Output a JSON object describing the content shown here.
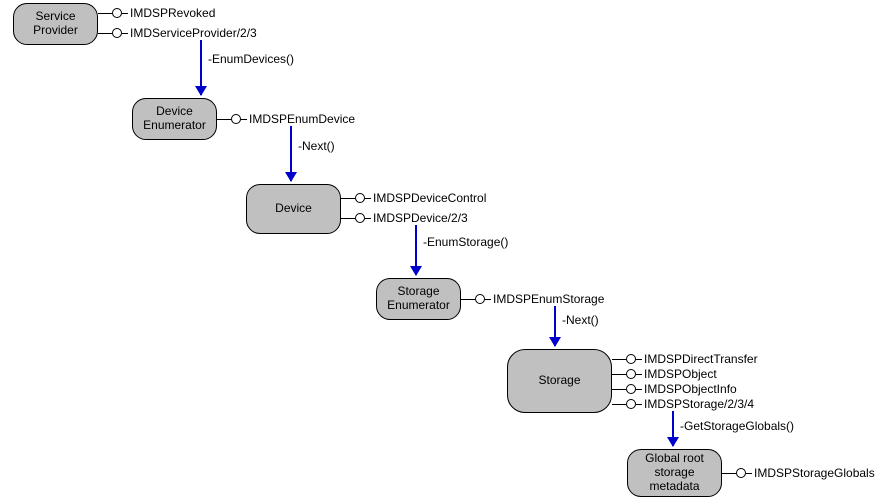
{
  "nodes": {
    "service_provider": "Service\nProvider",
    "device_enumerator": "Device\nEnumerator",
    "device": "Device",
    "storage_enumerator": "Storage\nEnumerator",
    "storage": "Storage",
    "global_root": "Global root\nstorage\nmetadata"
  },
  "interfaces": {
    "sp1": "IMDSPRevoked",
    "sp2": "IMDServiceProvider/2/3",
    "de1": "IMDSPEnumDevice",
    "dv1": "IMDSPDeviceControl",
    "dv2": "IMDSPDevice/2/3",
    "se1": "IMDSPEnumStorage",
    "st1": "IMDSPDirectTransfer",
    "st2": "IMDSPObject",
    "st3": "IMDSPObjectInfo",
    "st4": "IMDSPStorage/2/3/4",
    "gr1": "IMDSPStorageGlobals"
  },
  "edges": {
    "e1": "-EnumDevices()",
    "e2": "-Next()",
    "e3": "-EnumStorage()",
    "e4": "-Next()",
    "e5": "-GetStorageGlobals()"
  }
}
